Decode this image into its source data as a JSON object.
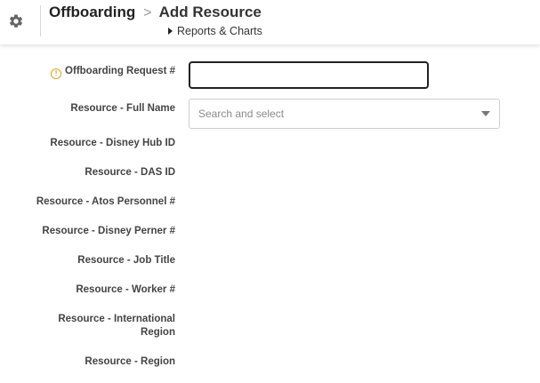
{
  "header": {
    "breadcrumb_parent": "Offboarding",
    "breadcrumb_separator": ">",
    "page_title": "Add Resource",
    "reports_link": "Reports & Charts",
    "settings_icon": "gear-icon"
  },
  "form": {
    "offboarding_request": {
      "label": "Offboarding Request #",
      "value": "",
      "icon": "info-icon"
    },
    "full_name": {
      "label": "Resource - Full Name",
      "placeholder": "Search and select"
    },
    "fields": {
      "disney_hub_id": "Resource - Disney Hub ID",
      "das_id": "Resource - DAS ID",
      "atos_personnel": "Resource - Atos Personnel #",
      "disney_perner": "Resource - Disney Perner #",
      "job_title": "Resource - Job Title",
      "worker": "Resource - Worker #",
      "international_region": "Resource - International Region",
      "region": "Resource - Region"
    }
  },
  "colors": {
    "info_accent": "#e6a117",
    "focus_border": "#222222"
  }
}
